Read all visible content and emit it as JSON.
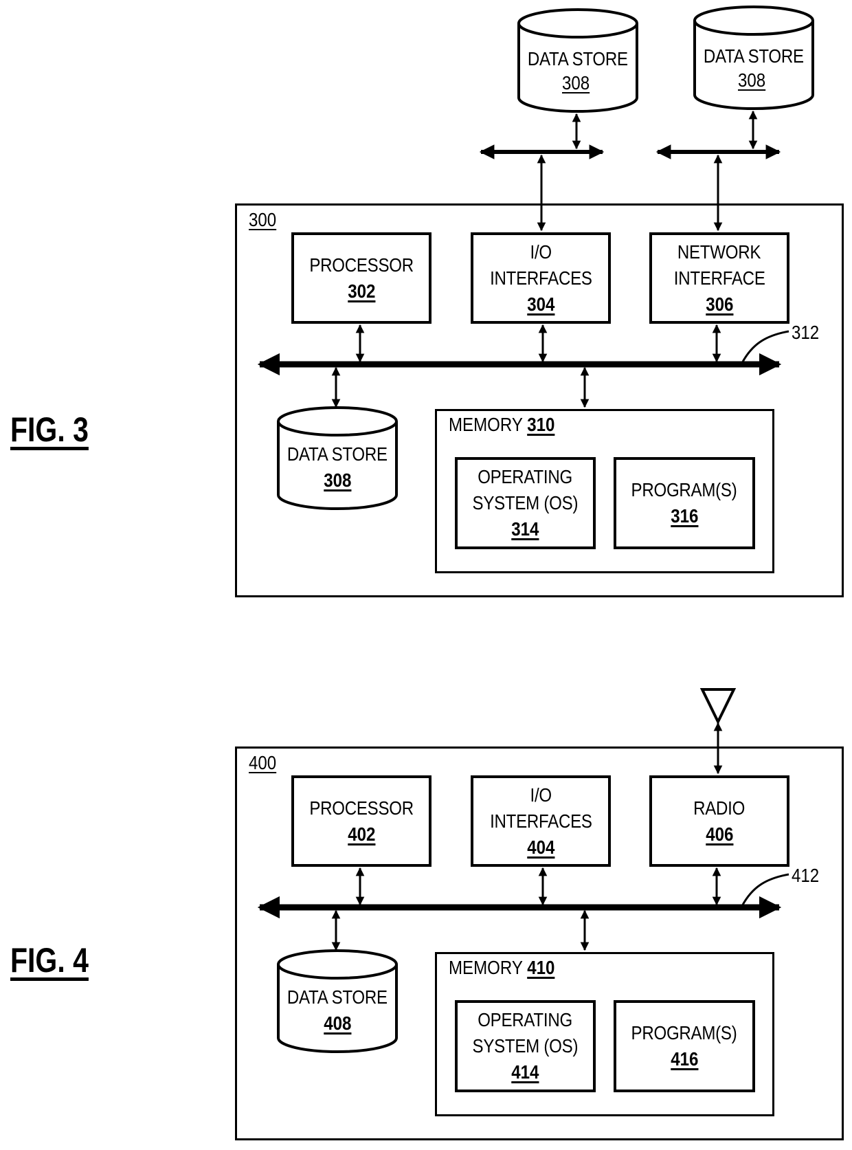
{
  "figures": [
    {
      "caption": "FIG. 3",
      "device_ref": "300",
      "bus_ref": "312",
      "top_blocks": [
        {
          "lines": [
            "PROCESSOR"
          ],
          "ref": "302"
        },
        {
          "lines": [
            "I/O",
            "INTERFACES"
          ],
          "ref": "304"
        },
        {
          "lines": [
            "NETWORK",
            "INTERFACE"
          ],
          "ref": "306"
        }
      ],
      "data_store": {
        "label": "DATA STORE",
        "ref": "308"
      },
      "memory": {
        "label": "MEMORY",
        "ref": "310",
        "children": [
          {
            "lines": [
              "OPERATING",
              "SYSTEM (OS)"
            ],
            "ref": "314"
          },
          {
            "lines": [
              "PROGRAM(S)"
            ],
            "ref": "316"
          }
        ]
      },
      "external_data_stores": [
        {
          "label": "DATA STORE",
          "ref": "308"
        },
        {
          "label": "DATA STORE",
          "ref": "308"
        }
      ]
    },
    {
      "caption": "FIG. 4",
      "device_ref": "400",
      "bus_ref": "412",
      "top_blocks": [
        {
          "lines": [
            "PROCESSOR"
          ],
          "ref": "402"
        },
        {
          "lines": [
            "I/O",
            "INTERFACES"
          ],
          "ref": "404"
        },
        {
          "lines": [
            "RADIO"
          ],
          "ref": "406"
        }
      ],
      "data_store": {
        "label": "DATA STORE",
        "ref": "408"
      },
      "memory": {
        "label": "MEMORY",
        "ref": "410",
        "children": [
          {
            "lines": [
              "OPERATING",
              "SYSTEM (OS)"
            ],
            "ref": "414"
          },
          {
            "lines": [
              "PROGRAM(S)"
            ],
            "ref": "416"
          }
        ]
      },
      "antenna": "antenna"
    }
  ]
}
